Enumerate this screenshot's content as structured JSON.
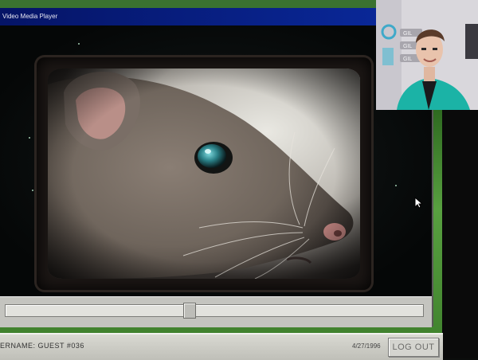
{
  "window": {
    "title": "Video Media Player"
  },
  "player": {
    "seek_progress": 0.44,
    "video_subject": "rat-closeup"
  },
  "taskbar": {
    "username": "ERNAME: GUEST #036",
    "date": "4/27/1996",
    "logout_label": "LOG OUT"
  },
  "webcam": {
    "sign_labels": [
      "GIL",
      "GIL",
      "GIL"
    ]
  },
  "colors": {
    "titlebar": "#051466",
    "chrome": "#c7c7c2",
    "jacket": "#1bb3a6"
  }
}
